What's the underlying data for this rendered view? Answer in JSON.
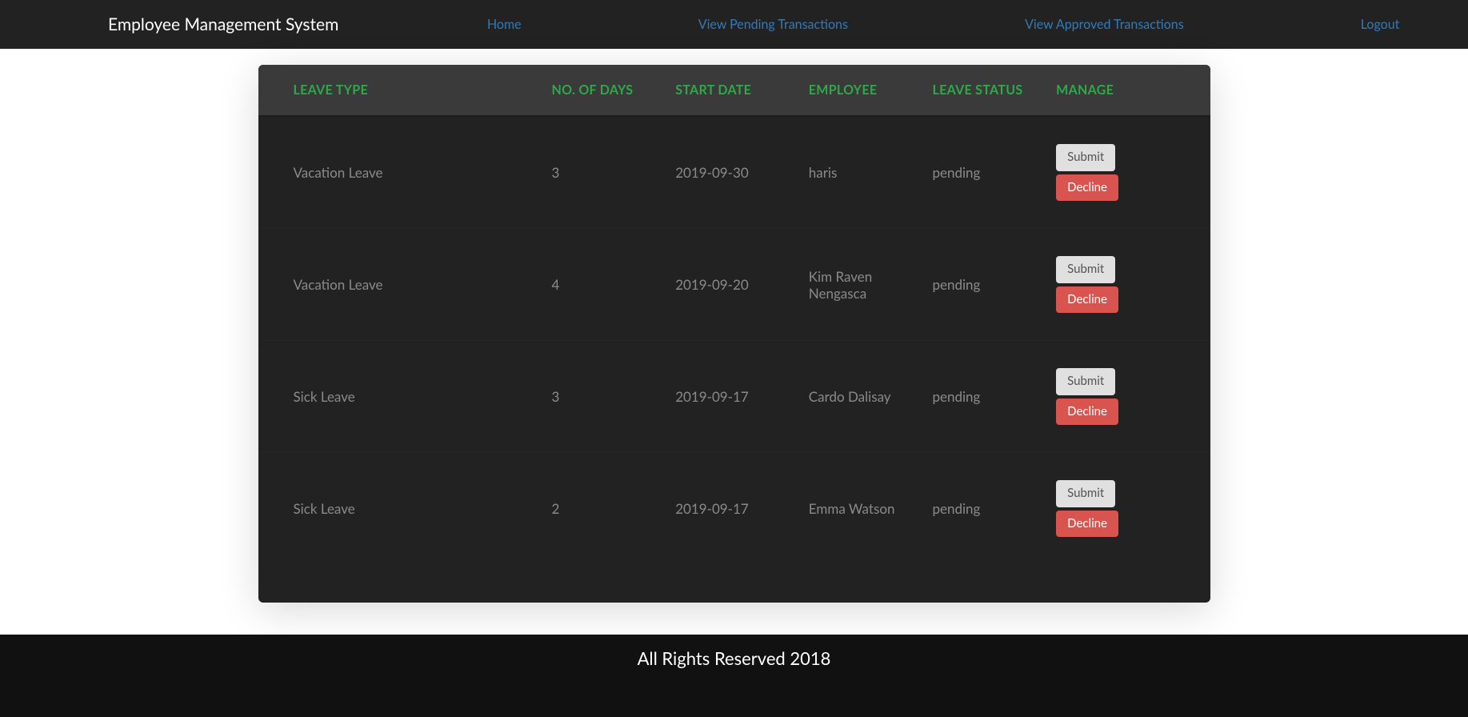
{
  "navbar": {
    "brand": "Employee Management System",
    "links": {
      "home": "Home",
      "pending": "View Pending Transactions",
      "approved": "View Approved Transactions",
      "logout": "Logout"
    }
  },
  "table": {
    "headers": {
      "leave_type": "LEAVE TYPE",
      "days": "NO. OF DAYS",
      "start_date": "START DATE",
      "employee": "EMPLOYEE",
      "status": "LEAVE STATUS",
      "manage": "MANAGE"
    },
    "rows": [
      {
        "leave_type": "Vacation Leave",
        "days": "3",
        "start_date": "2019-09-30",
        "employee": "haris",
        "status": "pending"
      },
      {
        "leave_type": "Vacation Leave",
        "days": "4",
        "start_date": "2019-09-20",
        "employee": "Kim Raven Nengasca",
        "status": "pending"
      },
      {
        "leave_type": "Sick Leave",
        "days": "3",
        "start_date": "2019-09-17",
        "employee": "Cardo Dalisay",
        "status": "pending"
      },
      {
        "leave_type": "Sick Leave",
        "days": "2",
        "start_date": "2019-09-17",
        "employee": "Emma Watson",
        "status": "pending"
      }
    ],
    "buttons": {
      "submit": "Submit",
      "decline": "Decline"
    }
  },
  "footer": {
    "text": "All Rights Reserved 2018"
  }
}
